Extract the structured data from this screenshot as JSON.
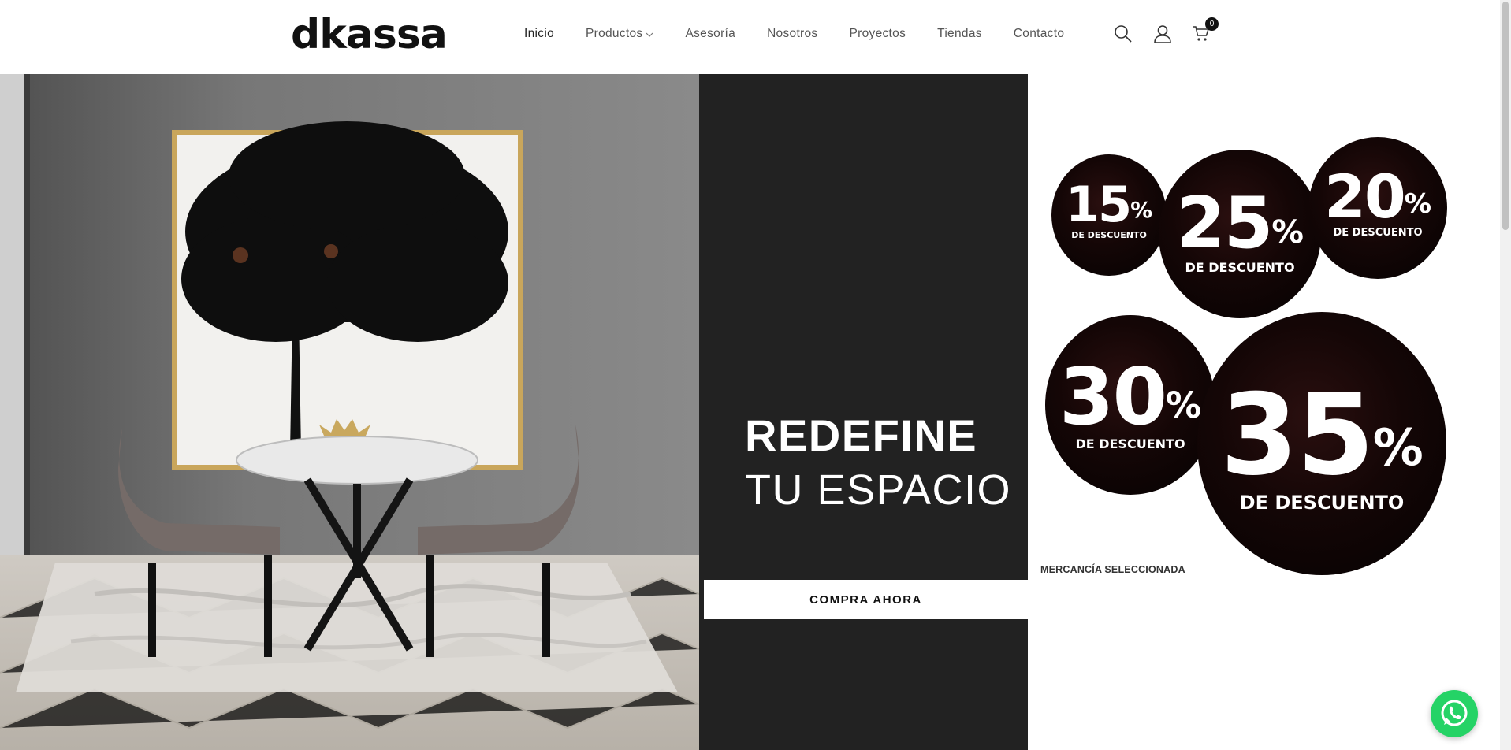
{
  "brand": {
    "logo_text": "dkassa"
  },
  "nav": {
    "items": [
      {
        "label": "Inicio",
        "active": true
      },
      {
        "label": "Productos",
        "has_dropdown": true
      },
      {
        "label": "Asesoría"
      },
      {
        "label": "Nosotros"
      },
      {
        "label": "Proyectos"
      },
      {
        "label": "Tiendas"
      },
      {
        "label": "Contacto"
      }
    ]
  },
  "header_icons": {
    "search": "search-icon",
    "account": "user-icon",
    "cart": "cart-icon",
    "cart_count": "0"
  },
  "hero": {
    "headline_line1": "REDEFINE",
    "headline_line2": "TU ESPACIO",
    "cta_label": "COMPRA AHORA"
  },
  "promo": {
    "discounts": [
      {
        "percent": "15",
        "symbol": "%",
        "label": "DE DESCUENTO"
      },
      {
        "percent": "25",
        "symbol": "%",
        "label": "DE DESCUENTO"
      },
      {
        "percent": "20",
        "symbol": "%",
        "label": "DE DESCUENTO"
      },
      {
        "percent": "30",
        "symbol": "%",
        "label": "DE DESCUENTO"
      },
      {
        "percent": "35",
        "symbol": "%",
        "label": "DE DESCUENTO"
      }
    ],
    "footnote": "MERCANCÍA SELECCIONADA"
  },
  "colors": {
    "panel": "#222222",
    "whatsapp": "#25d366",
    "text_dark": "#222222"
  },
  "floating": {
    "whatsapp_icon": "whatsapp-icon"
  }
}
